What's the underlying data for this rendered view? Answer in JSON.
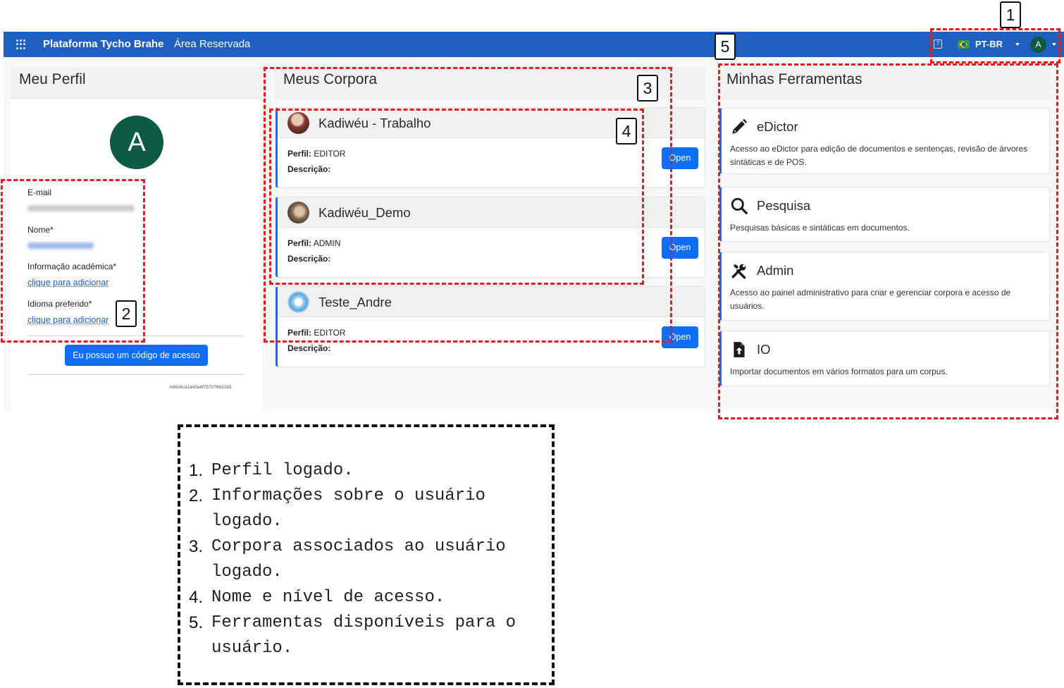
{
  "header": {
    "brand": "Plataforma Tycho Brahe",
    "subtitle": "Área Reservada",
    "language": "PT-BR",
    "user_initial": "A"
  },
  "profile": {
    "title": "Meu Perfil",
    "avatar_initial": "A",
    "email_label": "E-mail",
    "name_label": "Nome*",
    "academic_label": "Informação acadêmica*",
    "academic_link": "clique para adicionar",
    "language_label": "Idioma preferido*",
    "language_link": "clique para adicionar",
    "access_button": "Eu possuo um código de acesso",
    "user_hash": "A66c6ca1a40a4f757076b2285"
  },
  "corpora": {
    "title": "Meus Corpora",
    "profile_label": "Perfil:",
    "description_label": "Descrição:",
    "open_label": "Open",
    "items": [
      {
        "name": "Kadiwéu - Trabalho",
        "role": "EDITOR"
      },
      {
        "name": "Kadiwéu_Demo",
        "role": "ADMIN"
      },
      {
        "name": "Teste_Andre",
        "role": "EDITOR"
      }
    ]
  },
  "tools": {
    "title": "Minhas Ferramentas",
    "items": [
      {
        "name": "eDictor",
        "icon": "pencil-icon",
        "description": "Acesso ao eDictor para edição de documentos e sentenças, revisão de árvores sintáticas e de POS."
      },
      {
        "name": "Pesquisa",
        "icon": "search-icon",
        "description": "Pesquisas básicas e sintáticas em documentos."
      },
      {
        "name": "Admin",
        "icon": "tools-icon",
        "description": "Acesso ao painel administrativo para criar e gerenciar corpora e acesso de usuários."
      },
      {
        "name": "IO",
        "icon": "file-upload-icon",
        "description": "Importar documentos em vários formatos para um corpus."
      }
    ]
  },
  "annotations": {
    "markers": [
      "1",
      "2",
      "3",
      "4",
      "5"
    ],
    "legend": [
      {
        "n": "1.",
        "text": "Perfil logado."
      },
      {
        "n": "2.",
        "text": "Informações sobre o usuário logado."
      },
      {
        "n": "3.",
        "text": "Corpora associados ao usuário logado."
      },
      {
        "n": "4.",
        "text": "Nome e nível de acesso."
      },
      {
        "n": "5.",
        "text": "Ferramentas disponíveis para o usuário."
      }
    ]
  },
  "colors": {
    "topbar": "#1f5fbf",
    "primary": "#0d6efd",
    "avatar": "#0c5b44",
    "annotation": "#e8191f"
  }
}
